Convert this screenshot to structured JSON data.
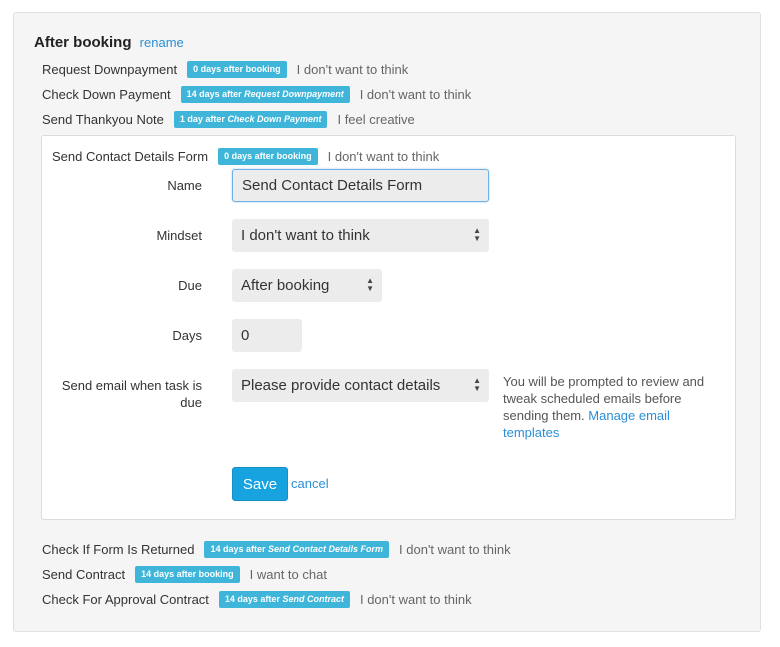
{
  "section": {
    "title": "After booking",
    "rename_label": "rename"
  },
  "tasks_before": [
    {
      "name": "Request Downpayment",
      "badge_prefix": "0 days after booking",
      "badge_ref": "",
      "mindset": "I don't want to think"
    },
    {
      "name": "Check Down Payment",
      "badge_prefix": "14 days after ",
      "badge_ref": "Request Downpayment",
      "mindset": "I don't want to think"
    },
    {
      "name": "Send Thankyou Note",
      "badge_prefix": "1 day after ",
      "badge_ref": "Check Down Payment",
      "mindset": "I feel creative"
    }
  ],
  "editing_task": {
    "name": "Send Contact Details Form",
    "badge_prefix": "0 days after booking",
    "mindset": "I don't want to think"
  },
  "form": {
    "name_label": "Name",
    "name_value": "Send Contact Details Form",
    "mindset_label": "Mindset",
    "mindset_value": "I don't want to think",
    "due_label": "Due",
    "due_value": "After booking",
    "days_label": "Days",
    "days_value": "0",
    "email_label": "Send email when task is due",
    "email_value": "Please provide contact details",
    "help_text": "You will be prompted to review and tweak scheduled emails before sending them. ",
    "help_link": "Manage email templates",
    "save_label": "Save",
    "cancel_label": "cancel"
  },
  "tasks_after": [
    {
      "name": "Check If Form Is Returned",
      "badge_prefix": "14 days after ",
      "badge_ref": "Send Contact Details Form",
      "mindset": "I don't want to think"
    },
    {
      "name": "Send Contract",
      "badge_prefix": "14 days after booking",
      "badge_ref": "",
      "mindset": "I want to chat"
    },
    {
      "name": "Check For Approval Contract",
      "badge_prefix": "14 days after ",
      "badge_ref": "Send Contract",
      "mindset": "I don't want to think"
    }
  ],
  "colors": {
    "badge": "#3fb5d9",
    "link": "#2a8fd6",
    "save_button": "#17a3e0"
  }
}
